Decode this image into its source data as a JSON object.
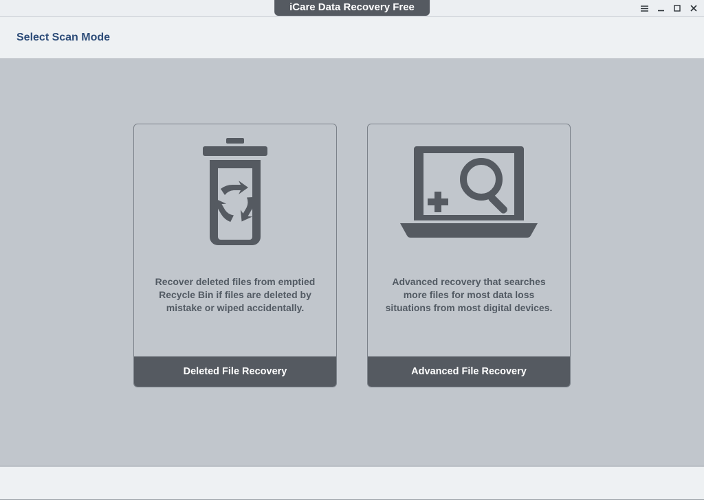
{
  "app": {
    "title": "iCare Data Recovery Free"
  },
  "header": {
    "title": "Select Scan Mode"
  },
  "cards": {
    "deleted": {
      "description": "Recover deleted files from emptied Recycle Bin if files are deleted by mistake or wiped accidentally.",
      "button": "Deleted File Recovery"
    },
    "advanced": {
      "description": "Advanced recovery that searches more files for most data loss situations from most digital devices.",
      "button": "Advanced File Recovery"
    }
  }
}
